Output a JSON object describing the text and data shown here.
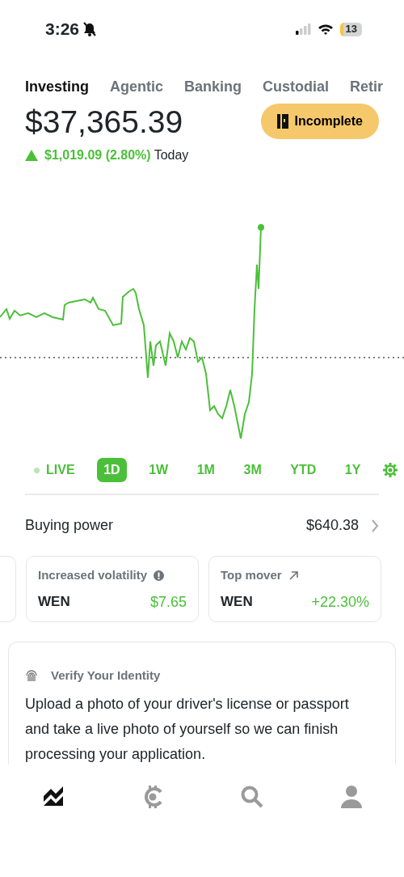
{
  "status_bar": {
    "time": "3:26",
    "battery": "13"
  },
  "tabs": [
    {
      "label": "Investing",
      "selected": true
    },
    {
      "label": "Agentic",
      "selected": false
    },
    {
      "label": "Banking",
      "selected": false
    },
    {
      "label": "Custodial",
      "selected": false
    },
    {
      "label": "Retir",
      "selected": false
    }
  ],
  "balance": "$37,365.39",
  "status_button": "Incomplete",
  "change": {
    "amount": "$1,019.09 (2.80%)",
    "period": "Today"
  },
  "ranges": [
    {
      "label": "LIVE",
      "kind": "live",
      "selected": false
    },
    {
      "label": "1D",
      "kind": "range",
      "selected": true
    },
    {
      "label": "1W",
      "kind": "range",
      "selected": false
    },
    {
      "label": "1M",
      "kind": "range",
      "selected": false
    },
    {
      "label": "3M",
      "kind": "range",
      "selected": false
    },
    {
      "label": "YTD",
      "kind": "range",
      "selected": false
    },
    {
      "label": "1Y",
      "kind": "range",
      "selected": false
    }
  ],
  "buying_power": {
    "label": "Buying power",
    "value": "$640.38"
  },
  "cards": [
    {
      "title": "Increased volatility",
      "kind": "alert",
      "symbol": "WEN",
      "value": "$7.65"
    },
    {
      "title": "Top mover",
      "kind": "mover",
      "symbol": "WEN",
      "value": "+22.30%"
    }
  ],
  "notice": {
    "title": "Verify Your Identity",
    "text": "Upload a photo of your driver's license or passport and take a live photo of yourself so we can finish processing your application."
  },
  "bottom_nav": [
    {
      "selected": true
    },
    {
      "selected": false
    },
    {
      "selected": false
    },
    {
      "selected": false
    }
  ]
}
